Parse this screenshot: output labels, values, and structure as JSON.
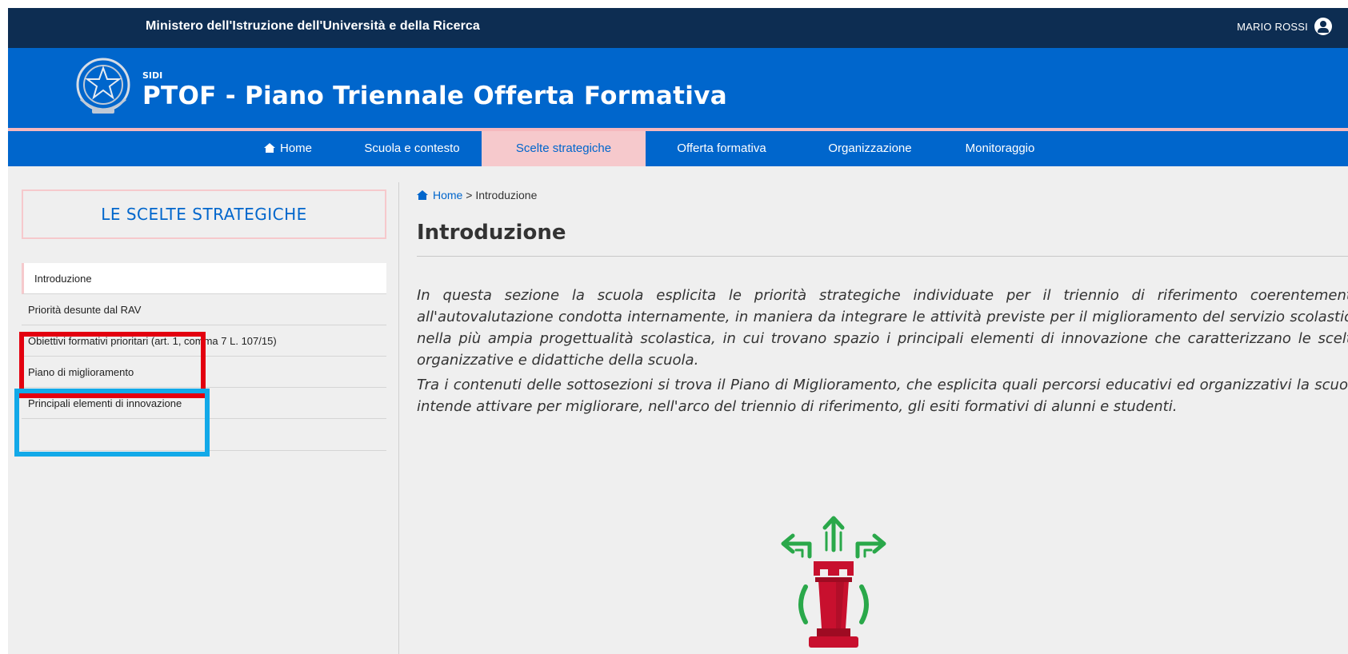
{
  "topbar": {
    "ministry": "Ministero dell'Istruzione dell'Università e della Ricerca",
    "user_name": "MARIO ROSSI",
    "user_icon": "user-circle-icon"
  },
  "header": {
    "sidi": "SIDI",
    "app_title": "PTOF - Piano Triennale Offerta Formativa",
    "emblem": "italian-republic-emblem"
  },
  "nav": {
    "items": [
      {
        "label": "Home",
        "icon": "home-icon"
      },
      {
        "label": "Scuola e contesto"
      },
      {
        "label": "Scelte strategiche",
        "active": true
      },
      {
        "label": "Offerta formativa"
      },
      {
        "label": "Organizzazione"
      },
      {
        "label": "Monitoraggio"
      }
    ]
  },
  "sidebar": {
    "heading": "LE SCELTE STRATEGICHE",
    "items": [
      {
        "label": "Introduzione",
        "active": true
      },
      {
        "label": "Priorità desunte dal RAV"
      },
      {
        "label": "Obiettivi formativi prioritari (art. 1, comma 7 L. 107/15)"
      },
      {
        "label": "Piano di miglioramento"
      },
      {
        "label": "Principali elementi di innovazione"
      }
    ]
  },
  "breadcrumb": {
    "home": "Home",
    "separator": ">",
    "current": "Introduzione"
  },
  "main": {
    "title": "Introduzione",
    "paragraphs": [
      "In questa sezione la scuola esplicita le priorità strategiche individuate per il triennio di riferimento coerentemente all'autovalutazione condotta internamente, in maniera da integrare le attività previste per il miglioramento del servizio scolastico nella più ampia progettualità scolastica, in cui trovano spazio i principali elementi di innovazione che caratterizzano le scelte organizzative e didattiche della scuola.",
      "Tra i contenuti delle sottosezioni si trova il Piano di Miglioramento, che esplicita quali percorsi educativi ed organizzativi la scuola intende attivare per migliorare, nell'arco del triennio di riferimento, gli esiti formativi di alunni e studenti."
    ],
    "illustration": "chess-rook-strategy-icon"
  },
  "colors": {
    "topbar": "#0d2d52",
    "primary": "#0066cc",
    "active_tab": "#f6c9cc",
    "annotation_red": "#e3000f",
    "annotation_blue": "#12a9e8"
  }
}
